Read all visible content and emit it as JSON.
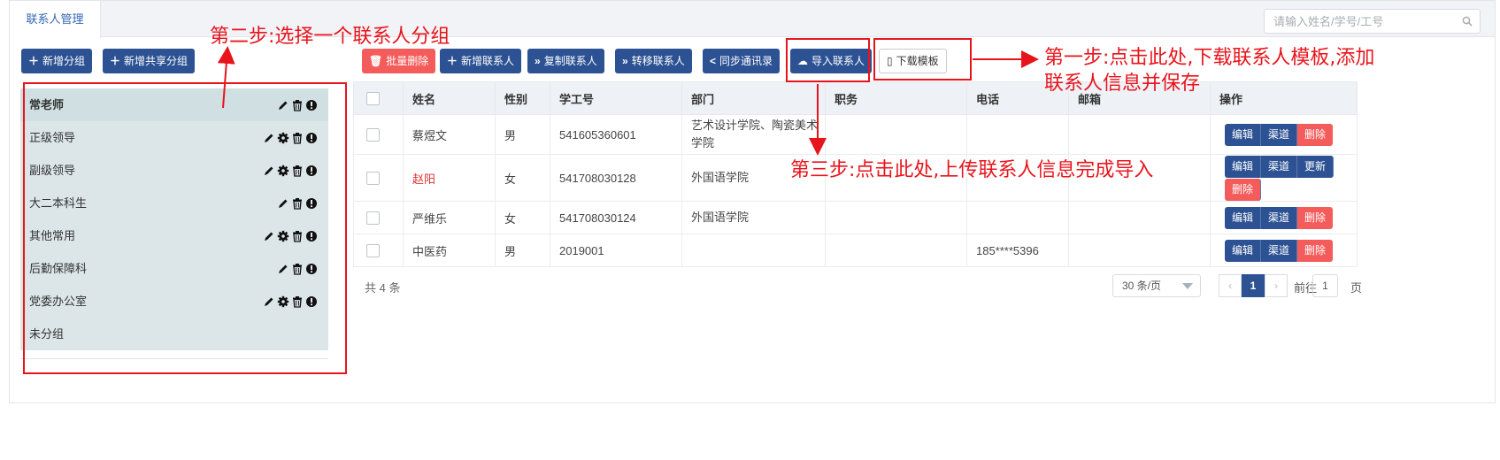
{
  "tabs": {
    "active": "联系人管理"
  },
  "search": {
    "placeholder": "请输入姓名/学号/工号"
  },
  "left_buttons": {
    "add_group": "新增分组",
    "add_shared_group": "新增共享分组"
  },
  "toolbar": {
    "batch_delete": "批量删除",
    "add_contact": "新增联系人",
    "copy_contact": "复制联系人",
    "move_contact": "转移联系人",
    "sync_contacts": "同步通讯录",
    "import_contacts": "导入联系人",
    "download_template": "下载模板"
  },
  "groups": [
    {
      "label": "常老师",
      "icons": [
        "pencil-icon",
        "trash-icon",
        "info-icon"
      ],
      "selected": true
    },
    {
      "label": "正级领导",
      "icons": [
        "pencil-icon",
        "gear-icon",
        "trash-icon",
        "info-icon"
      ]
    },
    {
      "label": "副级领导",
      "icons": [
        "pencil-icon",
        "gear-icon",
        "trash-icon",
        "info-icon"
      ]
    },
    {
      "label": "大二本科生",
      "icons": [
        "pencil-icon",
        "trash-icon",
        "info-icon"
      ]
    },
    {
      "label": "其他常用",
      "icons": [
        "pencil-icon",
        "gear-icon",
        "trash-icon",
        "info-icon"
      ]
    },
    {
      "label": "后勤保障科",
      "icons": [
        "pencil-icon",
        "trash-icon",
        "info-icon"
      ]
    },
    {
      "label": "党委办公室",
      "icons": [
        "pencil-icon",
        "gear-icon",
        "trash-icon",
        "info-icon"
      ]
    },
    {
      "label": "未分组",
      "icons": []
    }
  ],
  "table": {
    "headers": [
      "",
      "姓名",
      "性别",
      "学工号",
      "部门",
      "职务",
      "电话",
      "邮箱",
      "操作"
    ],
    "rows": [
      {
        "name": "蔡煜文",
        "gender": "男",
        "id": "541605360601",
        "dept": "艺术设计学院、陶瓷美术学院",
        "title": "",
        "phone": "",
        "email": "",
        "ops": [
          "编辑",
          "渠道",
          "删除"
        ]
      },
      {
        "name": "赵阳",
        "gender": "女",
        "id": "541708030128",
        "dept": "外国语学院",
        "title": "",
        "phone": "",
        "email": "",
        "ops": [
          "编辑",
          "渠道",
          "更新",
          "删除"
        ],
        "highlight": true
      },
      {
        "name": "严维乐",
        "gender": "女",
        "id": "541708030124",
        "dept": "外国语学院",
        "title": "",
        "phone": "",
        "email": "",
        "ops": [
          "编辑",
          "渠道",
          "删除"
        ]
      },
      {
        "name": "中医药",
        "gender": "男",
        "id": "2019001",
        "dept": "",
        "title": "",
        "phone": "185****5396",
        "email": "",
        "ops": [
          "编辑",
          "渠道",
          "删除"
        ]
      }
    ]
  },
  "pagination": {
    "total": "共 4 条",
    "page_size": "30 条/页",
    "current": "1",
    "goto_label": "前往",
    "goto_value": "1",
    "page_suffix": "页"
  },
  "annotations": {
    "step1_line1": "第一步:点击此处,下载联系人模板,添加",
    "step1_line2": "联系人信息并保存",
    "step2": "第二步:选择一个联系人分组",
    "step3": "第三步:点击此处,上传联系人信息完成导入"
  },
  "colors": {
    "primary": "#2d5293",
    "danger": "#f45b5b",
    "annotation": "#e8141c"
  }
}
